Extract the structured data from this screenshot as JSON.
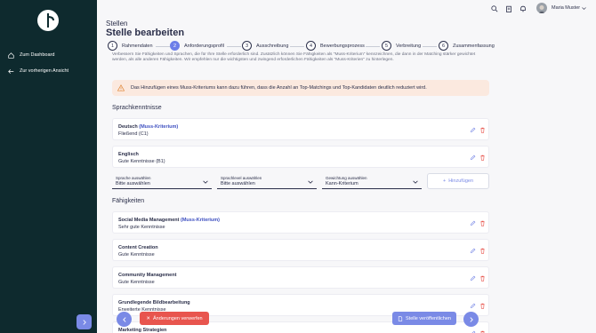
{
  "sidebar": {
    "items": [
      {
        "label": "Zum Dashboard",
        "icon": "home-icon"
      },
      {
        "label": "Zur vorherigen Ansicht",
        "icon": "arrow-left-icon"
      }
    ]
  },
  "user": {
    "name": "Maria Muster"
  },
  "header": {
    "super": "Stellen",
    "title": "Stelle bearbeiten"
  },
  "stepper": [
    {
      "num": "1",
      "label": "Rahmendaten"
    },
    {
      "num": "2",
      "label": "Anforderungsprofil",
      "active": true
    },
    {
      "num": "3",
      "label": "Ausschreibung"
    },
    {
      "num": "4",
      "label": "Bewerbungsprozess"
    },
    {
      "num": "5",
      "label": "Verbreitung"
    },
    {
      "num": "6",
      "label": "Zusammenfassung"
    }
  ],
  "intro_text": "Verbessern Sie Fähigkeiten und Sprachen, die für Ihre Stelle erforderlich sind. Zusätzlich können Sie Fähigkeiten als \"Muss-Kriterium\" kennzeichnen, die dann in der Matching stärker gewichtet werden, als alle anderen Fähigkeiten. Wir empfehlen nur die wichtigsten und zwingend erforderlichen Fähigkeiten als \"Muss-Kriterien\" zu hinterlegen.",
  "warning": "Das Hinzufügen eines Muss-Kriteriums kann dazu führen, dass die Anzahl an Top-Matchings und Top-Kandidaten deutlich reduziert wird.",
  "languages": {
    "title": "Sprachkenntnisse",
    "items": [
      {
        "name": "Deutsch",
        "muss": "(Muss-Kriterium)",
        "level": "Fließend (C1)"
      },
      {
        "name": "Englisch",
        "muss": "",
        "level": "Gute Kenntnisse (B1)"
      }
    ],
    "form": {
      "language": {
        "label": "Sprache auswählen",
        "value": "Bitte auswählen"
      },
      "level": {
        "label": "Sprachlevel auswählen",
        "value": "Bitte auswählen"
      },
      "weight": {
        "label": "Gewichtung auswählen",
        "value": "Kann-Kriterium"
      },
      "add_label": "Hinzufügen"
    }
  },
  "skills": {
    "title": "Fähigkeiten",
    "items": [
      {
        "name": "Social Media Management",
        "muss": "(Muss-Kriterium)",
        "level": "Sehr gute Kenntnisse"
      },
      {
        "name": "Content Creation",
        "muss": "",
        "level": "Gute Kenntnisse"
      },
      {
        "name": "Community Management",
        "muss": "",
        "level": "Gute Kenntnisse"
      },
      {
        "name": "Grundlegende Bildbearbeitung",
        "muss": "",
        "level": "Erweiterte Kenntnisse"
      },
      {
        "name": "Marketing Strategien",
        "muss": "",
        "level": ""
      }
    ]
  },
  "footer": {
    "discard_label": "Änderungen verwerfen",
    "publish_label": "Stelle veröffentlichen"
  },
  "colors": {
    "sidebar": "#0e2a2e",
    "accent": "#7a8ae6",
    "danger": "#e8554e",
    "warning_bg": "#fbe9df"
  }
}
